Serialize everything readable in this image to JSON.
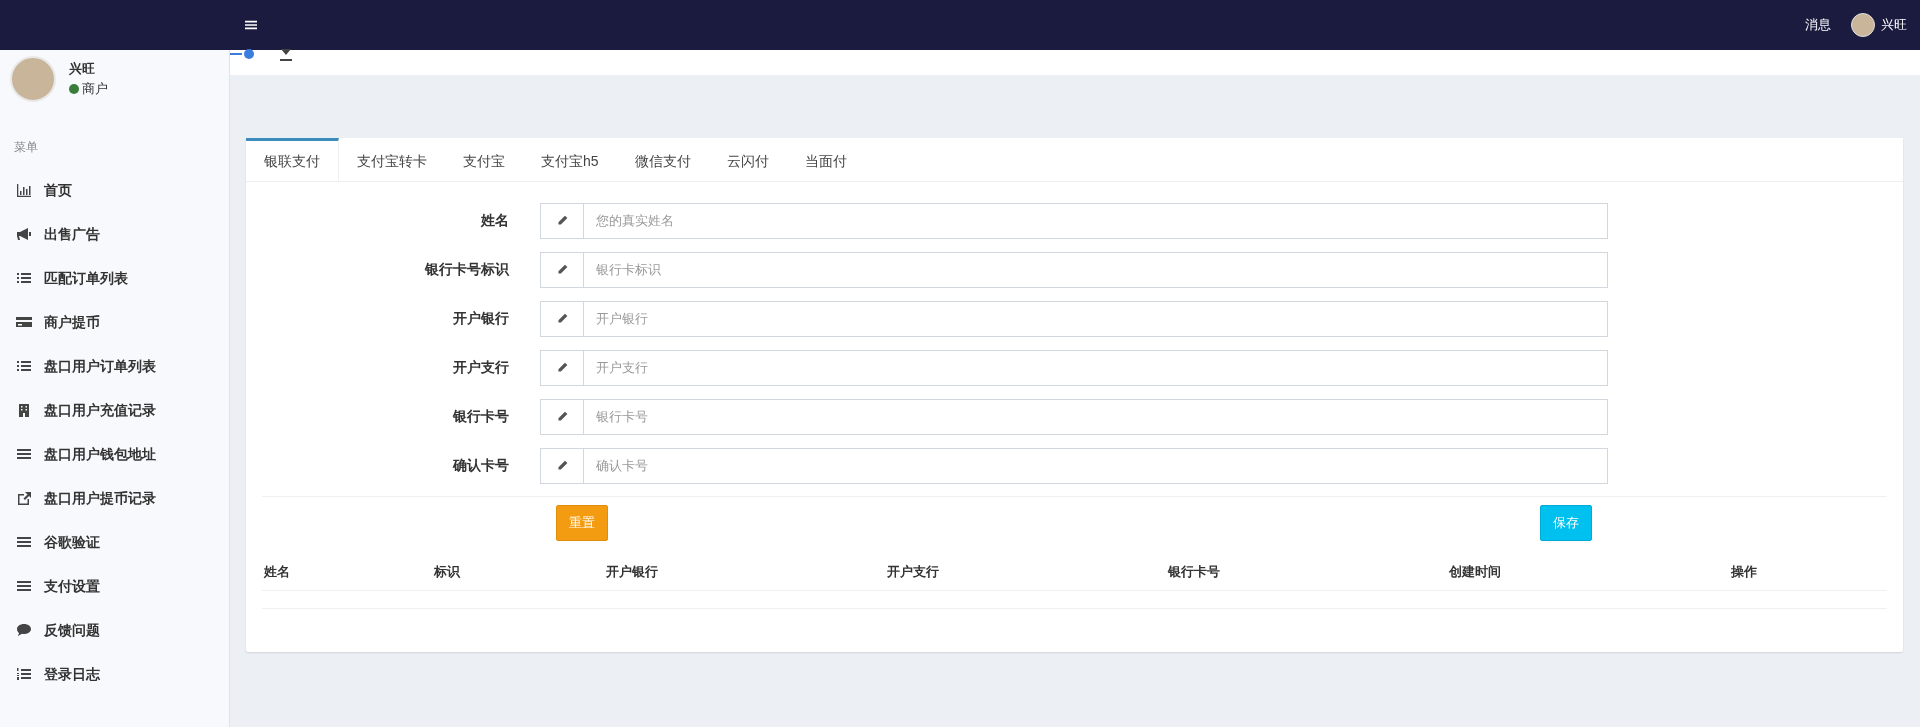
{
  "navbar": {
    "messages": "消息",
    "user_name": "兴旺"
  },
  "profile": {
    "name": "兴旺",
    "role": "商户"
  },
  "sidebar": {
    "header": "菜单",
    "items": [
      {
        "label": "首页"
      },
      {
        "label": "出售广告"
      },
      {
        "label": "匹配订单列表"
      },
      {
        "label": "商户提币"
      },
      {
        "label": "盘口用户订单列表"
      },
      {
        "label": "盘口用户充值记录"
      },
      {
        "label": "盘口用户钱包地址"
      },
      {
        "label": "盘口用户提币记录"
      },
      {
        "label": "谷歌验证"
      },
      {
        "label": "支付设置"
      },
      {
        "label": "反馈问题"
      },
      {
        "label": "登录日志"
      }
    ]
  },
  "tabs": [
    {
      "label": "银联支付",
      "selected": true
    },
    {
      "label": "支付宝转卡",
      "selected": false
    },
    {
      "label": "支付宝",
      "selected": false
    },
    {
      "label": "支付宝h5",
      "selected": false
    },
    {
      "label": "微信支付",
      "selected": false
    },
    {
      "label": "云闪付",
      "selected": false
    },
    {
      "label": "当面付",
      "selected": false
    }
  ],
  "form": {
    "fields": [
      {
        "label": "姓名",
        "placeholder": "您的真实姓名"
      },
      {
        "label": "银行卡号标识",
        "placeholder": "银行卡标识"
      },
      {
        "label": "开户银行",
        "placeholder": "开户银行"
      },
      {
        "label": "开户支行",
        "placeholder": "开户支行"
      },
      {
        "label": "银行卡号",
        "placeholder": "银行卡号"
      },
      {
        "label": "确认卡号",
        "placeholder": "确认卡号"
      }
    ],
    "reset_button": "重置",
    "save_button": "保存"
  },
  "table": {
    "columns": [
      "姓名",
      "标识",
      "开户银行",
      "开户支行",
      "银行卡号",
      "创建时间",
      "操作"
    ]
  }
}
